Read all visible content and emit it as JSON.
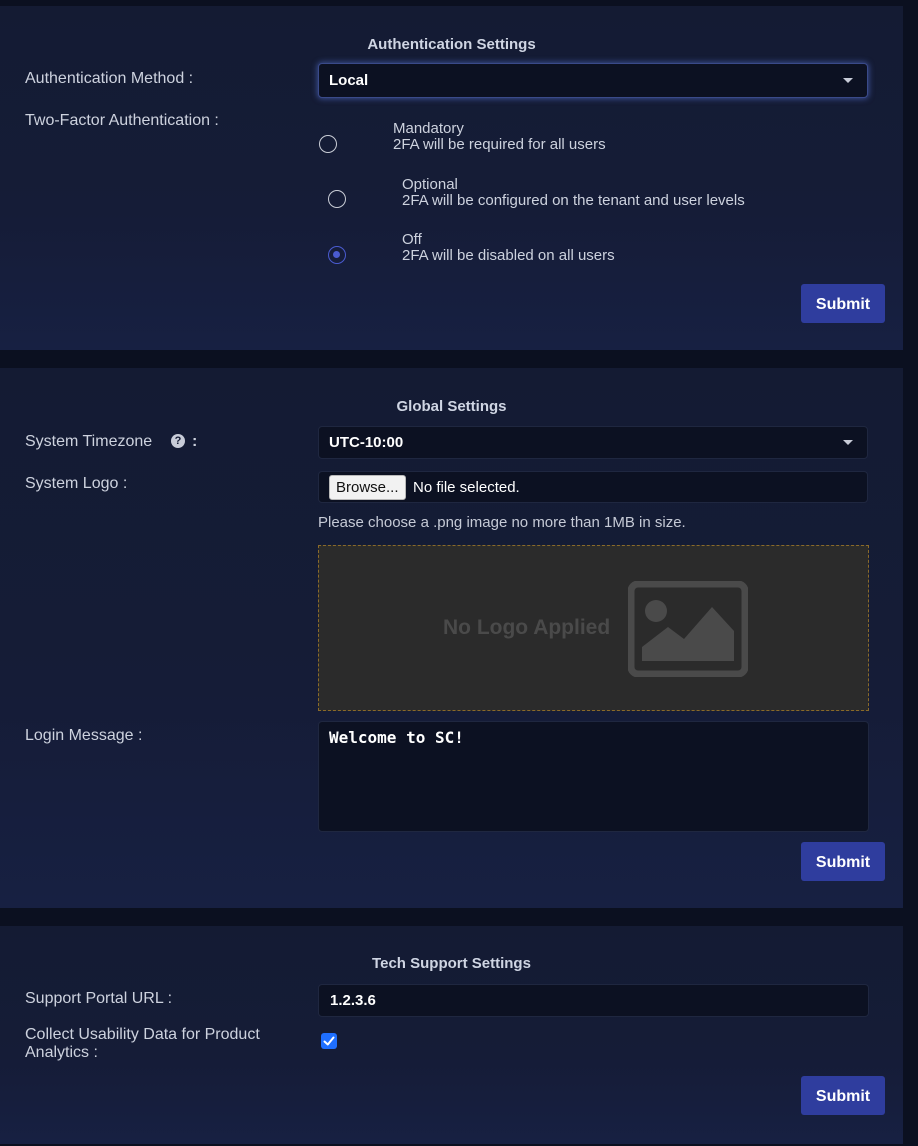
{
  "auth": {
    "title": "Authentication Settings",
    "method_label": "Authentication Method :",
    "method_value": "Local",
    "twofa_label": "Two-Factor Authentication :",
    "options": [
      {
        "title": "Mandatory",
        "desc": "2FA will be required for all users",
        "checked": false
      },
      {
        "title": "Optional",
        "desc": "2FA will be configured on the tenant and user levels",
        "checked": false
      },
      {
        "title": "Off",
        "desc": "2FA will be disabled on all users",
        "checked": true
      }
    ],
    "submit_label": "Submit"
  },
  "global": {
    "title": "Global Settings",
    "timezone_label": "System Timezone",
    "timezone_colon": ":",
    "help_glyph": "?",
    "timezone_value": "UTC-10:00",
    "logo_label": "System Logo :",
    "browse_label": "Browse...",
    "file_status": "No file selected.",
    "hint": "Please choose a .png image no more than 1MB in size.",
    "no_logo_text": "No Logo Applied",
    "login_message_label": "Login Message :",
    "login_message_value": "Welcome to SC!",
    "submit_label": "Submit"
  },
  "tech": {
    "title": "Tech Support Settings",
    "portal_label": "Support Portal URL :",
    "portal_value": "1.2.3.6",
    "analytics_label_line1": "Collect Usability Data for Product",
    "analytics_label_line2": "Analytics :",
    "analytics_checked": true,
    "submit_label": "Submit"
  },
  "icons": {
    "help": "question-circle-icon",
    "image": "image-placeholder-icon",
    "caret": "caret-down-icon",
    "check": "checkmark-icon"
  },
  "colors": {
    "accent": "#2f3d9e",
    "radio_checked": "#4a5bd0",
    "checkbox": "#1f6fff",
    "panel_bg": "#141b33",
    "page_bg": "#0b1020"
  }
}
